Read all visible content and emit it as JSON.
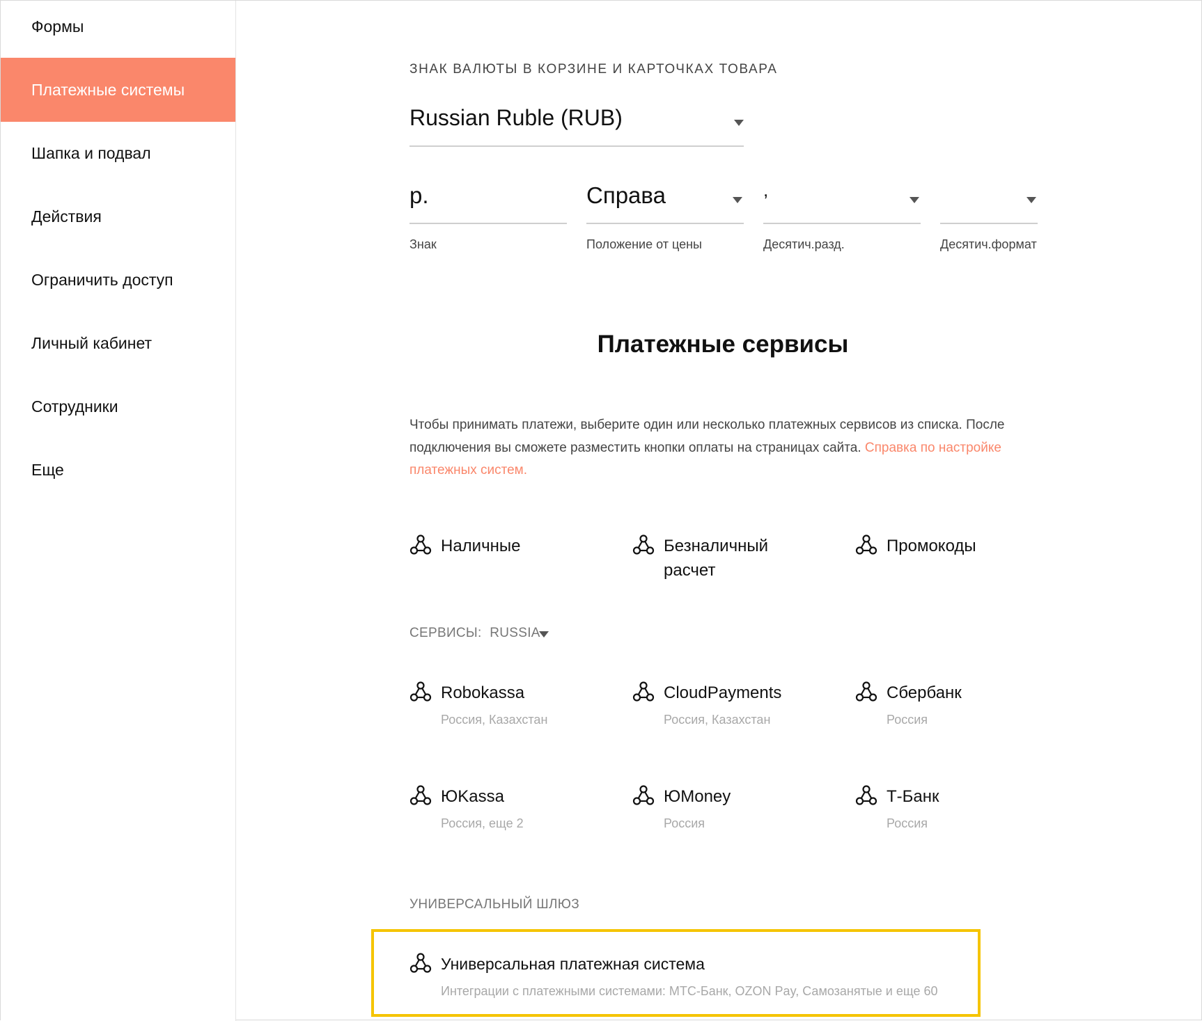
{
  "sidebar": {
    "items": [
      {
        "label": "Формы",
        "active": false
      },
      {
        "label": "Платежные системы",
        "active": true
      },
      {
        "label": "Шапка и подвал",
        "active": false
      },
      {
        "label": "Действия",
        "active": false
      },
      {
        "label": "Ограничить доступ",
        "active": false
      },
      {
        "label": "Личный кабинет",
        "active": false
      },
      {
        "label": "Сотрудники",
        "active": false
      },
      {
        "label": "Еще",
        "active": false
      }
    ]
  },
  "currency": {
    "section_title": "ЗНАК ВАЛЮТЫ В КОРЗИНЕ И КАРТОЧКАХ ТОВАРА",
    "selected": "Russian Ruble (RUB)",
    "sign": {
      "value": "р.",
      "label": "Знак"
    },
    "position": {
      "value": "Справа",
      "label": "Положение от цены"
    },
    "decimal_separator": {
      "value": ",",
      "label": "Десятич.разд."
    },
    "decimal_format": {
      "value": "",
      "label": "Десятич.формат"
    }
  },
  "services": {
    "title": "Платежные сервисы",
    "description": "Чтобы принимать платежи, выберите один или несколько платежных сервисов из списка. После подключения вы сможете разместить кнопки оплаты на страницах сайта.",
    "help_link": "Справка по настройке платежных систем.",
    "basic": [
      {
        "name": "Наличные"
      },
      {
        "name": "Безналичный расчет"
      },
      {
        "name": "Промокоды"
      }
    ],
    "country_filter": {
      "label": "СЕРВИСЫ:",
      "value": "RUSSIA"
    },
    "providers": [
      {
        "name": "Robokassa",
        "region": "Россия, Казахстан"
      },
      {
        "name": "CloudPayments",
        "region": "Россия, Казахстан"
      },
      {
        "name": "Сбербанк",
        "region": "Россия"
      },
      {
        "name": "ЮKassa",
        "region": "Россия, еще 2"
      },
      {
        "name": "ЮMoney",
        "region": "Россия"
      },
      {
        "name": "Т-Банк",
        "region": "Россия"
      }
    ],
    "gateway": {
      "section_title": "УНИВЕРСАЛЬНЫЙ ШЛЮЗ",
      "name": "Универсальная платежная система",
      "description": "Интеграции с платежными системами: МТС-Банк, OZON Pay, Самозанятые и еще 60"
    }
  },
  "colors": {
    "accent": "#fa876b",
    "highlight": "#f5c400",
    "muted_text": "#a8a8a8"
  }
}
